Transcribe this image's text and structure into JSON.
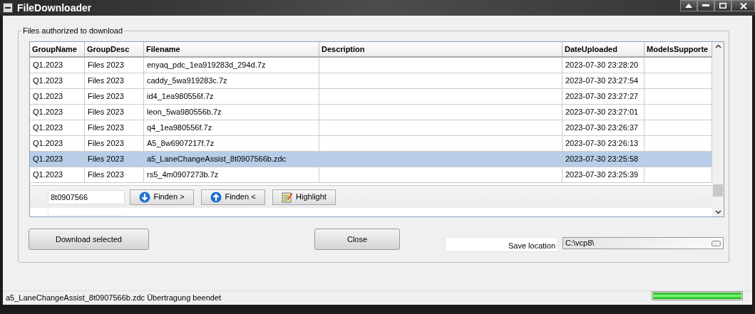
{
  "window": {
    "title": "FileDownloader"
  },
  "group_title": "Files authorized to download",
  "table": {
    "columns": [
      "GroupName",
      "GroupDesc",
      "Filename",
      "Description",
      "DateUploaded",
      "ModelsSupporte"
    ],
    "rows": [
      {
        "cells": [
          "Q1.2023",
          "Files 2023",
          "enyaq_pdc_1ea919283d_294d.7z",
          "",
          "2023-07-30 23:28:20",
          ""
        ],
        "selected": false
      },
      {
        "cells": [
          "Q1.2023",
          "Files 2023",
          "caddy_5wa919283c.7z",
          "",
          "2023-07-30 23:27:54",
          ""
        ],
        "selected": false
      },
      {
        "cells": [
          "Q1.2023",
          "Files 2023",
          "id4_1ea980556f.7z",
          "",
          "2023-07-30 23:27:27",
          ""
        ],
        "selected": false
      },
      {
        "cells": [
          "Q1.2023",
          "Files 2023",
          "leon_5wa980556b.7z",
          "",
          "2023-07-30 23:27:01",
          ""
        ],
        "selected": false
      },
      {
        "cells": [
          "Q1.2023",
          "Files 2023",
          "q4_1ea980556f.7z",
          "",
          "2023-07-30 23:26:37",
          ""
        ],
        "selected": false
      },
      {
        "cells": [
          "Q1.2023",
          "Files 2023",
          "A5_8w6907217f.7z",
          "",
          "2023-07-30 23:26:13",
          ""
        ],
        "selected": false
      },
      {
        "cells": [
          "Q1.2023",
          "Files 2023",
          "a5_LaneChangeAssist_8t0907566b.zdc",
          "",
          "2023-07-30 23:25:58",
          ""
        ],
        "selected": true
      },
      {
        "cells": [
          "Q1.2023",
          "Files 2023",
          "rs5_4m0907273b.7z",
          "",
          "2023-07-30 23:25:39",
          ""
        ],
        "selected": false
      }
    ]
  },
  "find": {
    "value": "8t0907566",
    "buttons": [
      {
        "kind": "down",
        "label": "Finden >"
      },
      {
        "kind": "up",
        "label": "Finden <"
      },
      {
        "kind": "highlight",
        "label": "Highlight"
      }
    ]
  },
  "download_button": "Download selected",
  "close_button": "Close",
  "save_location": {
    "label": "Save location",
    "value": "C:\\vcp8\\"
  },
  "status_bar": {
    "text": "a5_LaneChangeAssist_8t0907566b.zdc Übertragung beendet",
    "progress": {
      "level": 1
    }
  }
}
